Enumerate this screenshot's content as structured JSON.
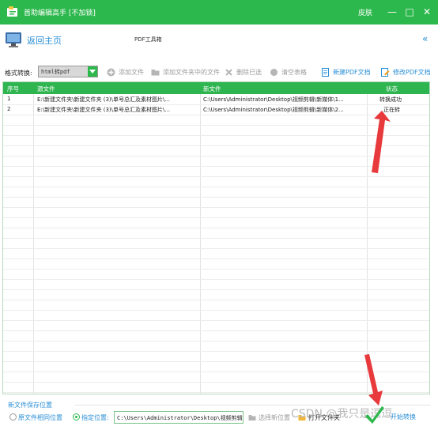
{
  "colors": {
    "brand": "#2db84d",
    "link": "#2a8fd6",
    "arrow": "#e8393c"
  },
  "titlebar": {
    "title": "首助编辑高手 [不加锁]",
    "skin": "皮肤",
    "minimize": "—",
    "maximize": "□",
    "close": "✕"
  },
  "header": {
    "home": "返回主页",
    "tool_title": "PDF工具箱",
    "collapse": "«"
  },
  "toolbar": {
    "format_label": "格式转换:",
    "format_value": "html转pdf",
    "add_file": "添加文件",
    "add_folder_files": "添加文件夹中的文件",
    "delete_selected": "删除已选",
    "clear_table": "清空表格",
    "new_pdf": "新建PDF文档",
    "edit_pdf": "修改PDF文档"
  },
  "table": {
    "columns": [
      "序号",
      "源文件",
      "新文件",
      "状态"
    ],
    "rows": [
      {
        "index": "1",
        "source": "E:\\新建文件夹\\新建文件夹 (3)\\单号总汇及素材图片\\...",
        "target": "C:\\Users\\Administrator\\Desktop\\视频剪辑\\新媒体\\1...",
        "status": "转换成功"
      },
      {
        "index": "2",
        "source": "E:\\新建文件夹\\新建文件夹 (3)\\单号总汇及素材图片\\...",
        "target": "C:\\Users\\Administrator\\Desktop\\视频剪辑\\新媒体\\2...",
        "status": "正在转"
      }
    ]
  },
  "bottom": {
    "save_title": "新文件保存位置",
    "opt_source": "原文件相同位置",
    "opt_custom": "指定位置:",
    "path_value": "C:\\Users\\Administrator\\Desktop\\视频剪辑\\新",
    "choose_location": "选择新位置",
    "open_folder": "打开文件夹",
    "start": "开始转换"
  },
  "watermark": "CSDN @我只是逗逗"
}
